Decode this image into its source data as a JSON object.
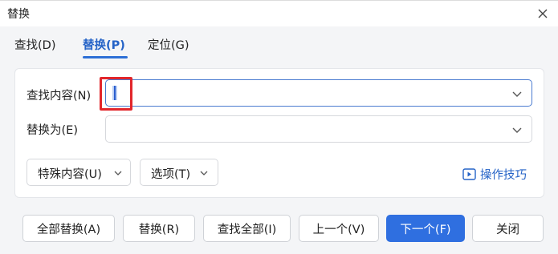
{
  "window": {
    "title": "替换"
  },
  "tabs": [
    {
      "label": "查找(D)",
      "active": false
    },
    {
      "label": "替换(P)",
      "active": true
    },
    {
      "label": "定位(G)",
      "active": false
    }
  ],
  "find": {
    "label": "查找内容(N)",
    "value": ""
  },
  "replace": {
    "label": "替换为(E)",
    "value": ""
  },
  "options": {
    "special_label": "特殊内容(U)",
    "options_label": "选项(T)",
    "tips_label": "操作技巧"
  },
  "buttons": {
    "replace_all": "全部替换(A)",
    "replace": "替换(R)",
    "find_all": "查找全部(I)",
    "previous": "上一个(V)",
    "next": "下一个(F)",
    "close": "关闭"
  },
  "colors": {
    "accent": "#2f6fe0",
    "active_tab": "#2563c7",
    "highlight": "#e2262b"
  },
  "icons": {
    "close": "close-icon",
    "dropdown": "chevron-down-icon",
    "tips": "play-square-icon"
  }
}
